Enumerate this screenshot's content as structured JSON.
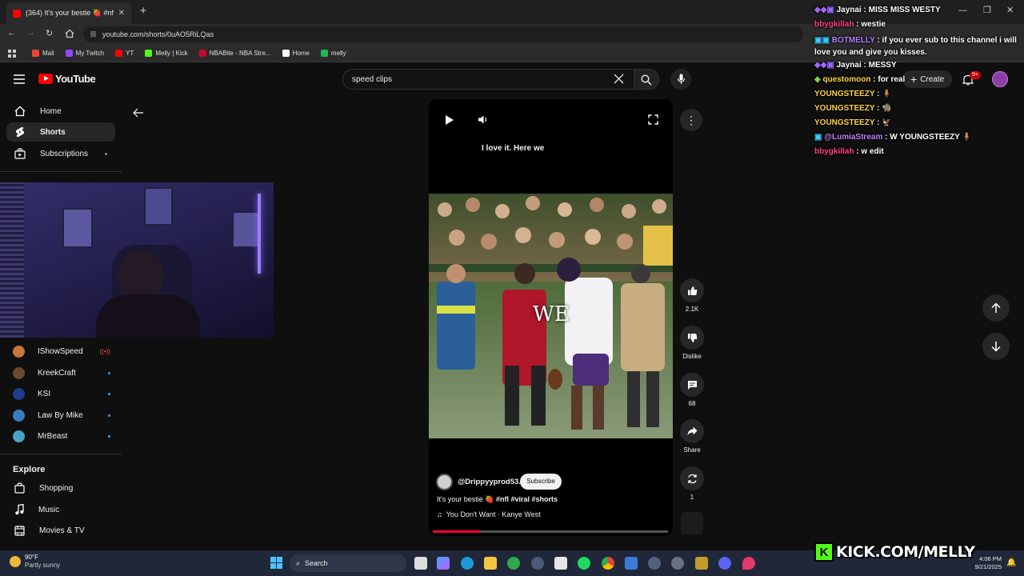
{
  "browser": {
    "tab_title": "(364) It's your bestie 🍓 #nfl #...",
    "url": "youtube.com/shorts/0uAO5RiLQas",
    "bookmarks": [
      {
        "label": "Mail",
        "color": "#ea4335"
      },
      {
        "label": "My Twitch",
        "color": "#9146ff"
      },
      {
        "label": "YT",
        "color": "#ff0000"
      },
      {
        "label": "Melly | Kick",
        "color": "#53fc18"
      },
      {
        "label": "NBABite - NBA Stre...",
        "color": "#c9082a"
      },
      {
        "label": "Home",
        "color": "#ffffff"
      },
      {
        "label": "melly",
        "color": "#1db954"
      }
    ]
  },
  "youtube": {
    "logo_text": "YouTube",
    "search_value": "speed clips",
    "create_label": "Create",
    "notif_badge": "9+",
    "nav": [
      {
        "label": "Home",
        "icon": "home-icon"
      },
      {
        "label": "Shorts",
        "icon": "shorts-icon"
      },
      {
        "label": "Subscriptions",
        "icon": "subscriptions-icon"
      }
    ],
    "subscriptions": [
      {
        "label": "IShowSpeed",
        "color": "#c8743a"
      },
      {
        "label": "KreekCraft",
        "color": "#6b4a2e"
      },
      {
        "label": "KSI",
        "color": "#1f3c8a"
      },
      {
        "label": "Law By Mike",
        "color": "#3b7bbf"
      },
      {
        "label": "MrBeast",
        "color": "#4aa3c7"
      }
    ],
    "explore_heading": "Explore",
    "explore": [
      {
        "label": "Shopping",
        "icon": "shopping-bag-icon"
      },
      {
        "label": "Music",
        "icon": "music-note-icon"
      },
      {
        "label": "Movies & TV",
        "icon": "film-icon"
      }
    ]
  },
  "short": {
    "caption": "I love it. Here we",
    "overlay_word": "WE",
    "channel": "@Drippyyprod53.",
    "subscribe_label": "Subscribe",
    "title_prefix": "It's your bestie 🍓 ",
    "hashtags": "#nfl #viral #shorts",
    "music": "You Don't Want · Kanye West",
    "progress_fraction": 0.2,
    "likes": "2.1K",
    "dislike_label": "Dislike",
    "comments": "68",
    "share_label": "Share",
    "remix_count": "1"
  },
  "chat": [
    {
      "user": "Jaynai",
      "msg": "MISS MISS WESTY",
      "color": "#ffffff",
      "badges": true
    },
    {
      "user": "bbygkillah",
      "msg": "westie",
      "color": "#ff3d8b",
      "badges": false
    },
    {
      "user": "BOTMELLY",
      "msg": "if you ever sub to this channel i will love you and give you kisses.",
      "color": "#b57bff",
      "badges": true
    },
    {
      "user": "Jaynai",
      "msg": "MESSY",
      "color": "#ffffff",
      "badges": true
    },
    {
      "user": "questomoon",
      "msg": "for real",
      "color": "#ffd23f",
      "badges": true
    },
    {
      "user": "YOUNGSTEEZY",
      "msg": "🧍",
      "color": "#ffd23f",
      "badges": false
    },
    {
      "user": "YOUNGSTEEZY",
      "msg": "🧌",
      "color": "#ffd23f",
      "badges": false
    },
    {
      "user": "YOUNGSTEEZY",
      "msg": "🦅",
      "color": "#ffd23f",
      "badges": false
    },
    {
      "user": "@LumiaStream",
      "msg": "W YOUNGSTEEZY 🧍",
      "color": "#c47cff",
      "badges": true
    },
    {
      "user": "bbygkillah",
      "msg": "w edit",
      "color": "#ff3d8b",
      "badges": false
    }
  ],
  "kick_banner": "KICK.COM/MELLY",
  "taskbar": {
    "weather_temp": "90°F",
    "weather_desc": "Partly sunny",
    "search_label": "Search",
    "time": "4:06 PM",
    "date": "9/21/2025"
  }
}
